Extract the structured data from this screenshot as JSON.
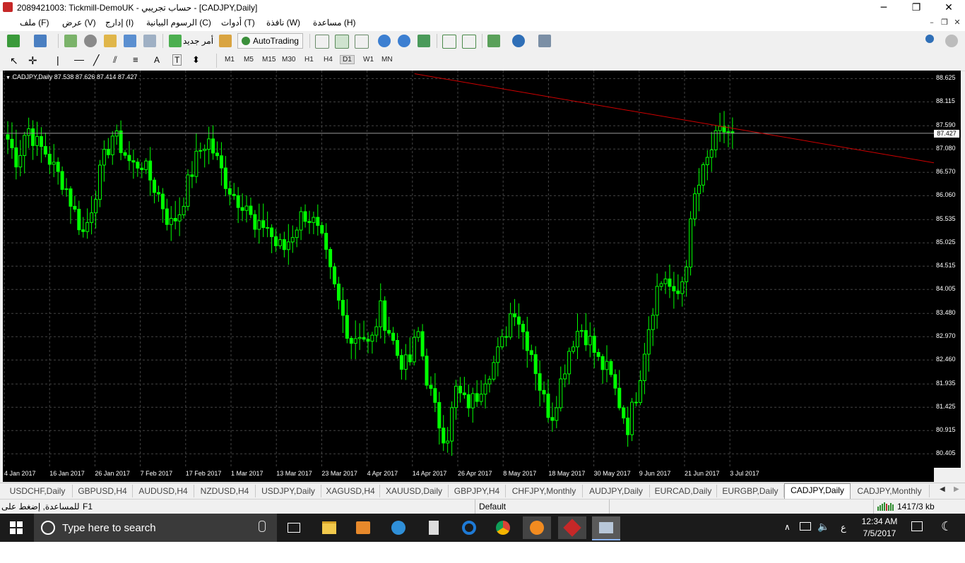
{
  "window": {
    "title": "2089421003: Tickmill-DemoUK - حساب تجريبي - [CADJPY,Daily]",
    "minimize_glyph": "─",
    "restore_glyph": "❐",
    "close_glyph": "✕"
  },
  "menu": {
    "items": [
      "ملف (F)",
      "عرض (V)",
      "إدارج (I)",
      "الرسوم البيانية (C)",
      "أدوات (T)",
      "نافذة (W)",
      "مساعدة (H)"
    ]
  },
  "toolbar": {
    "new_order_label": "أمر جديد",
    "autotrading_label": "AutoTrading",
    "text_tool_label": "A",
    "timeframes": [
      "M1",
      "M5",
      "M15",
      "M30",
      "H1",
      "H4",
      "D1",
      "W1",
      "MN"
    ],
    "active_timeframe": "D1"
  },
  "chart": {
    "info": "CADJPY,Daily  87.538 87.626 87.414 87.427",
    "current_price": "87.427",
    "price_ticks": [
      "88.625",
      "88.115",
      "87.590",
      "87.080",
      "86.570",
      "86.060",
      "85.535",
      "85.025",
      "84.515",
      "84.005",
      "83.480",
      "82.970",
      "82.460",
      "81.935",
      "81.425",
      "80.915",
      "80.405"
    ],
    "date_ticks": [
      "4 Jan 2017",
      "16 Jan 2017",
      "26 Jan 2017",
      "7 Feb 2017",
      "17 Feb 2017",
      "1 Mar 2017",
      "13 Mar 2017",
      "23 Mar 2017",
      "4 Apr 2017",
      "14 Apr 2017",
      "26 Apr 2017",
      "8 May 2017",
      "18 May 2017",
      "30 May 2017",
      "9 Jun 2017",
      "21 Jun 2017",
      "3 Jul 2017"
    ],
    "colors": {
      "background": "#000000",
      "candle": "#00ff00",
      "grid": "#444444",
      "trendline": "#d00000"
    }
  },
  "chart_data": {
    "type": "candlestick",
    "symbol": "CADJPY",
    "timeframe": "Daily",
    "ylim": [
      80.1,
      88.8
    ],
    "close_path": [
      87.3,
      86.8,
      87.6,
      87.2,
      87.0,
      86.6,
      86.3,
      85.7,
      85.2,
      86.0,
      86.8,
      87.4,
      87.1,
      86.7,
      86.8,
      86.4,
      86.0,
      85.4,
      85.7,
      86.4,
      87.0,
      87.3,
      86.8,
      86.3,
      86.0,
      85.9,
      85.2,
      85.5,
      85.0,
      84.9,
      85.3,
      85.7,
      85.5,
      85.0,
      84.2,
      83.5,
      82.9,
      83.1,
      82.7,
      83.6,
      83.1,
      82.5,
      82.3,
      83.1,
      82.0,
      81.2,
      80.7,
      81.8,
      81.5,
      81.6,
      82.1,
      82.4,
      82.9,
      83.7,
      83.1,
      82.6,
      81.7,
      81.2,
      82.0,
      82.8,
      83.2,
      82.9,
      82.4,
      82.2,
      81.6,
      81.0,
      81.8,
      83.0,
      84.0,
      84.3,
      83.7,
      84.4,
      86.0,
      86.6,
      87.2,
      87.5,
      87.43
    ],
    "trendline": {
      "from": {
        "date": "2017-04-13",
        "price": 88.73
      },
      "to_price_at_right_edge": 86.78
    }
  },
  "tabs": [
    "USDCHF,Daily",
    "GBPUSD,H4",
    "AUDUSD,H4",
    "NZDUSD,H4",
    "USDJPY,Daily",
    "XAGUSD,H4",
    "XAUUSD,Daily",
    "GBPJPY,H4",
    "CHFJPY,Monthly",
    "AUDJPY,Daily",
    "EURCAD,Daily",
    "EURGBP,Daily",
    "CADJPY,Daily",
    "CADJPY,Monthly"
  ],
  "active_tab": "CADJPY,Daily",
  "statusbar": {
    "help_text": "للمساعدة, إضغط على",
    "help_key": "F1",
    "profile": "Default",
    "connection": "1417/3 kb"
  },
  "taskbar": {
    "search_placeholder": "Type here to search",
    "time": "12:34 AM",
    "date": "7/5/2017",
    "input_lang": "ع"
  }
}
